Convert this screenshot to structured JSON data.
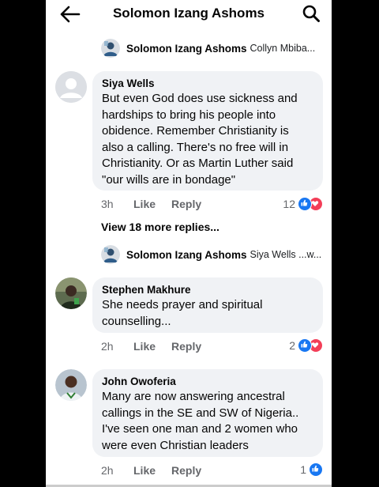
{
  "header": {
    "title": "Solomon Izang Ashoms"
  },
  "reply_lines": [
    {
      "name": "Solomon Izang Ashoms",
      "preview": "Collyn Mbiba..."
    },
    {
      "name": "Solomon Izang Ashoms",
      "preview": "Siya Wells ...w..."
    }
  ],
  "comments": [
    {
      "author": "Siya Wells",
      "text": "But even God does use sickness and hardships to bring his people into obidence. Remember Christianity is also a calling. There's no free will in Christianity. Or as Martin Luther said \"our wills are in bondage\"",
      "time": "3h",
      "like": "Like",
      "reply": "Reply",
      "reactions": "12"
    },
    {
      "author": "Stephen Makhure",
      "text": "She needs prayer and spiritual counselling...",
      "time": "2h",
      "like": "Like",
      "reply": "Reply",
      "reactions": "2"
    },
    {
      "author": "John Owoferia",
      "text": "Many are now answering ancestral callings in the SE and SW of Nigeria.. I've seen one man and 2 women who were even Christian leaders",
      "time": "2h",
      "like": "Like",
      "reply": "Reply",
      "reactions": "1"
    }
  ],
  "view_more": "View 18 more replies...",
  "colors": {
    "like_blue": "#1877f2",
    "love_red": "#f33e58",
    "bubble": "#f0f2f5",
    "meta": "#65676b"
  }
}
